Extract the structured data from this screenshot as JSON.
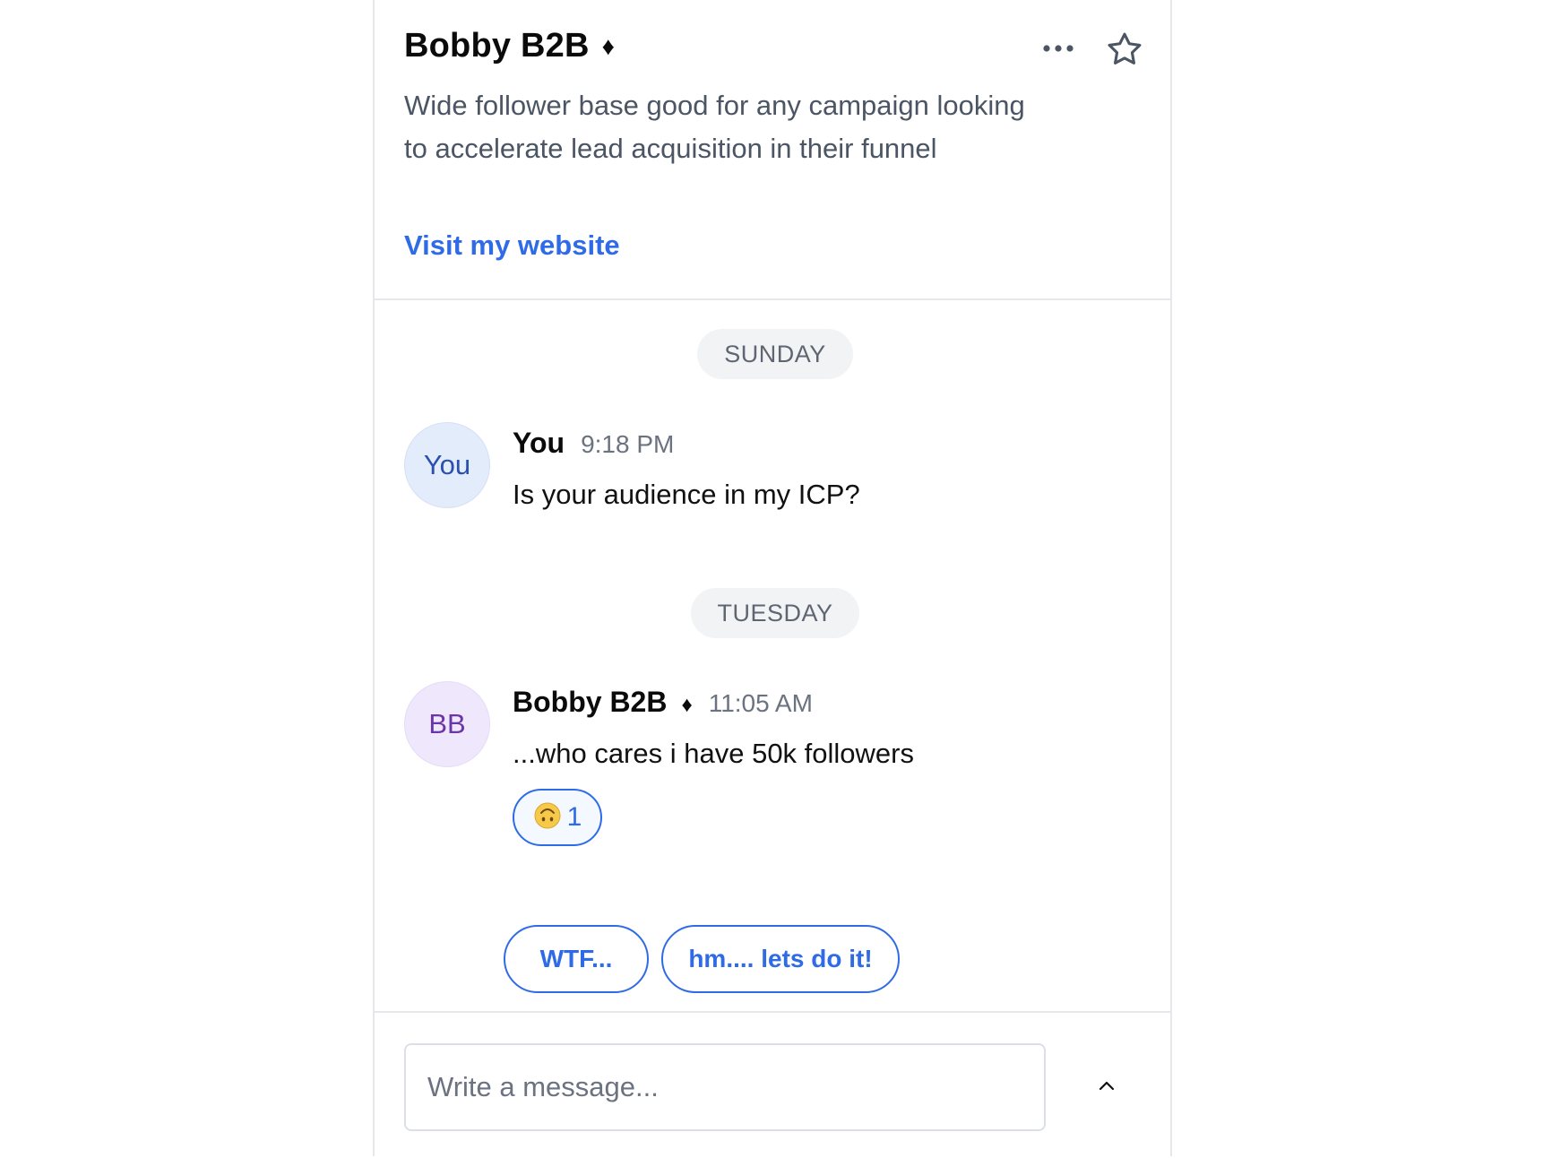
{
  "header": {
    "title": "Bobby B2B",
    "title_badge": "♦",
    "description": "Wide follower base good for any campaign looking to accelerate lead acquisition in their funnel",
    "website_link": "Visit my website",
    "more_icon": "more-horizontal-icon",
    "favorite_icon": "star-outline-icon"
  },
  "conversation": {
    "day_separators": [
      "SUNDAY",
      "TUESDAY"
    ],
    "messages": [
      {
        "avatar_text": "You",
        "sender": "You",
        "time": "9:18 PM",
        "text": "Is your audience in my ICP?"
      },
      {
        "avatar_text": "BB",
        "sender": "Bobby B2B",
        "sender_badge": "♦",
        "time": "11:05 AM",
        "text": "...who cares i have 50k followers",
        "reaction": {
          "emoji": "🙃",
          "icon": "upside-down-face-emoji",
          "count": "1"
        }
      }
    ],
    "quick_replies": [
      "WTF...",
      "hm.... lets do it!"
    ]
  },
  "composer": {
    "placeholder": "Write a message...",
    "value": "",
    "expand_icon": "chevron-up-icon"
  },
  "colors": {
    "accent": "#2f6be6",
    "muted_text": "#6b7280",
    "border": "#e5e7eb",
    "pill_bg": "#f2f3f5",
    "avatar_you_bg": "#e3ecfb",
    "avatar_bb_bg": "#efe7fb"
  }
}
